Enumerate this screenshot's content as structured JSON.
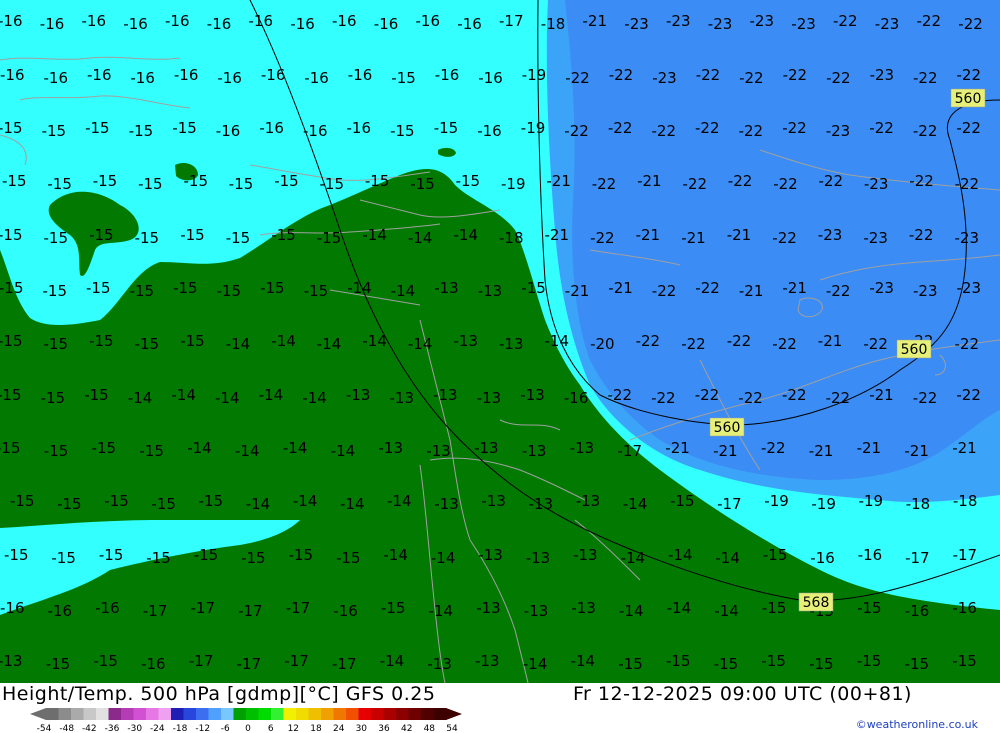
{
  "header": {
    "product": "Height/Temp. 500 hPa [gdmp][°C] GFS 0.25",
    "valid_time": "Fr 12-12-2025 09:00 UTC (00+81)",
    "credit": "©weatheronline.co.uk"
  },
  "legend": {
    "ticks": [
      "-54",
      "-48",
      "-42",
      "-36",
      "-30",
      "-24",
      "-18",
      "-12",
      "-6",
      "0",
      "6",
      "12",
      "18",
      "24",
      "30",
      "36",
      "42",
      "48",
      "54"
    ],
    "colors": [
      "#6e6e6e",
      "#8c8c8c",
      "#aaaaaa",
      "#c8c8c8",
      "#e1e1e1",
      "#8c2a8c",
      "#b43cb4",
      "#d250d2",
      "#e678e6",
      "#f0a0f0",
      "#1e1eb4",
      "#2846dc",
      "#3c6ef0",
      "#50a0ff",
      "#78c8ff",
      "#00a000",
      "#00be00",
      "#00dc00",
      "#32f032",
      "#f0f000",
      "#f0dc00",
      "#f0c000",
      "#f0a000",
      "#f07800",
      "#f05000",
      "#e60000",
      "#c80000",
      "#aa0000",
      "#8c0000",
      "#6e0000",
      "#500000",
      "#3c0000"
    ]
  },
  "colors": {
    "cyan": "#33ffff",
    "light_blue": "#3ca4f8",
    "mid_blue": "#3b8cf5",
    "green": "#027a02",
    "contour": "#000000",
    "border": "#a0a0a0"
  },
  "isohypse_labels": [
    "560",
    "560",
    "560",
    "568"
  ],
  "temperature_rows": [
    [
      "-16",
      "-16",
      "-16",
      "-16",
      "-16",
      "-16",
      "-16",
      "-16",
      "-16",
      "-16",
      "-16",
      "-16",
      "-17",
      "-18",
      "-21",
      "-23",
      "-23",
      "-23",
      "-23",
      "-23",
      "-22",
      "-23",
      "-22",
      "-22"
    ],
    [
      "-16",
      "-16",
      "-16",
      "-16",
      "-16",
      "-16",
      "-16",
      "-16",
      "-16",
      "-15",
      "-16",
      "-16",
      "-19",
      "-22",
      "-22",
      "-23",
      "-22",
      "-22",
      "-22",
      "-22",
      "-23",
      "-22",
      "-22"
    ],
    [
      "-15",
      "-15",
      "-15",
      "-15",
      "-15",
      "-16",
      "-16",
      "-16",
      "-16",
      "-15",
      "-15",
      "-16",
      "-19",
      "-22",
      "-22",
      "-22",
      "-22",
      "-22",
      "-22",
      "-23",
      "-22",
      "-22",
      "-22"
    ],
    [
      "-15",
      "-15",
      "-15",
      "-15",
      "-15",
      "-15",
      "-15",
      "-15",
      "-15",
      "-15",
      "-15",
      "-19",
      "-21",
      "-22",
      "-21",
      "-22",
      "-22",
      "-22",
      "-22",
      "-23",
      "-22",
      "-22"
    ],
    [
      "-15",
      "-15",
      "-15",
      "-15",
      "-15",
      "-15",
      "-15",
      "-15",
      "-14",
      "-14",
      "-14",
      "-18",
      "-21",
      "-22",
      "-21",
      "-21",
      "-21",
      "-22",
      "-23",
      "-23",
      "-22",
      "-23"
    ],
    [
      "-15",
      "-15",
      "-15",
      "-15",
      "-15",
      "-15",
      "-15",
      "-15",
      "-14",
      "-14",
      "-13",
      "-13",
      "-15",
      "-21",
      "-21",
      "-22",
      "-22",
      "-21",
      "-21",
      "-22",
      "-23",
      "-23",
      "-23"
    ],
    [
      "-15",
      "-15",
      "-15",
      "-15",
      "-15",
      "-14",
      "-14",
      "-14",
      "-14",
      "-14",
      "-13",
      "-13",
      "-14",
      "-20",
      "-22",
      "-22",
      "-22",
      "-22",
      "-21",
      "-22",
      "-22",
      "-22"
    ],
    [
      "-15",
      "-15",
      "-15",
      "-14",
      "-14",
      "-14",
      "-14",
      "-14",
      "-13",
      "-13",
      "-13",
      "-13",
      "-13",
      "-16",
      "-22",
      "-22",
      "-22",
      "-22",
      "-22",
      "-22",
      "-21",
      "-22",
      "-22"
    ],
    [
      "-15",
      "-15",
      "-15",
      "-15",
      "-14",
      "-14",
      "-14",
      "-14",
      "-13",
      "-13",
      "-13",
      "-13",
      "-13",
      "-17",
      "-21",
      "-21",
      "-22",
      "-21",
      "-21",
      "-21",
      "-21"
    ],
    [
      "-15",
      "-15",
      "-15",
      "-15",
      "-15",
      "-14",
      "-14",
      "-14",
      "-14",
      "-13",
      "-13",
      "-13",
      "-13",
      "-14",
      "-15",
      "-17",
      "-19",
      "-19",
      "-19",
      "-18",
      "-18"
    ],
    [
      "-15",
      "-15",
      "-15",
      "-15",
      "-15",
      "-15",
      "-15",
      "-15",
      "-14",
      "-14",
      "-13",
      "-13",
      "-13",
      "-14",
      "-14",
      "-14",
      "-15",
      "-16",
      "-16",
      "-17",
      "-17"
    ],
    [
      "-16",
      "-16",
      "-16",
      "-17",
      "-17",
      "-17",
      "-17",
      "-16",
      "-15",
      "-14",
      "-13",
      "-13",
      "-13",
      "-14",
      "-14",
      "-14",
      "-15",
      "-15",
      "-15",
      "-16",
      "-16"
    ],
    [
      "-13",
      "-15",
      "-15",
      "-16",
      "-17",
      "-17",
      "-17",
      "-17",
      "-14",
      "-13",
      "-13",
      "-14",
      "-14",
      "-15",
      "-15",
      "-15",
      "-15",
      "-15",
      "-15",
      "-15",
      "-15"
    ]
  ]
}
